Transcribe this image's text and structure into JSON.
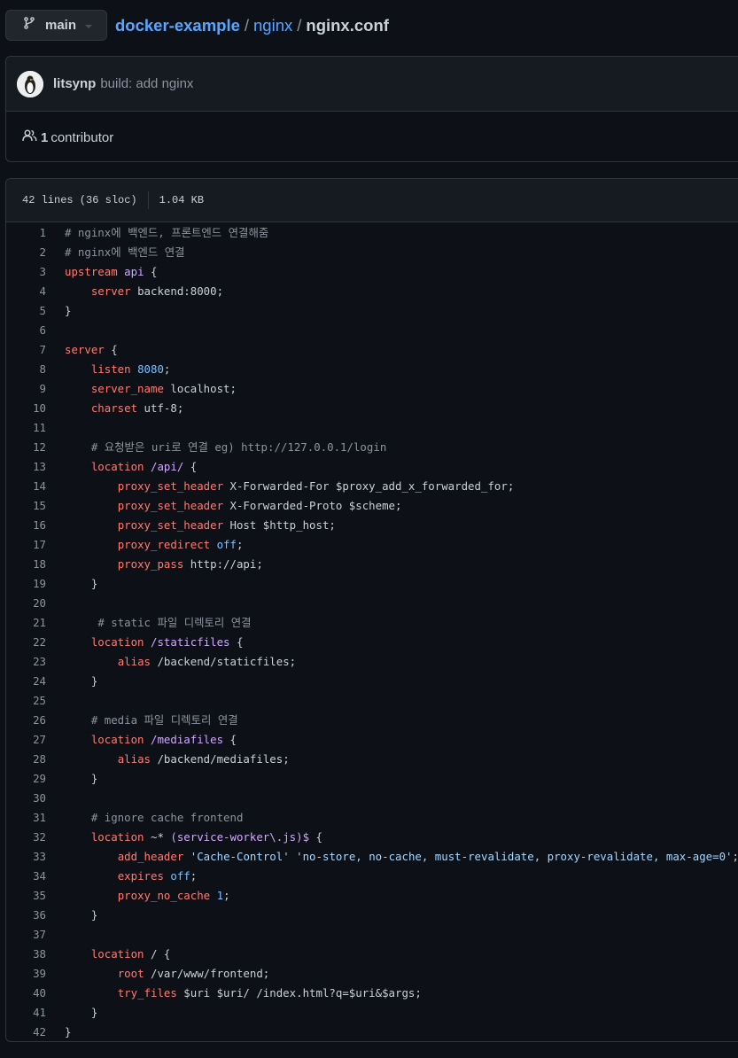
{
  "branch": {
    "name": "main"
  },
  "breadcrumb": {
    "repo": "docker-example",
    "dir": "nginx",
    "file": "nginx.conf"
  },
  "commit": {
    "author": "litsynp",
    "message": "build: add nginx"
  },
  "contributors": {
    "count": "1",
    "label": "contributor"
  },
  "file_info": {
    "lines": "42 lines (36 sloc)",
    "size": "1.04 KB"
  },
  "code_lines": [
    [
      [
        "com",
        "# nginx에 백엔드, 프론트엔드 연결해줌"
      ]
    ],
    [
      [
        "com",
        "# nginx에 백엔드 연결"
      ]
    ],
    [
      [
        "kw",
        "upstream"
      ],
      [
        "",
        " "
      ],
      [
        "id",
        "api"
      ],
      [
        "",
        " {"
      ]
    ],
    [
      [
        "",
        "    "
      ],
      [
        "kw",
        "server"
      ],
      [
        "",
        " backend:8000;"
      ]
    ],
    [
      [
        "",
        "}"
      ]
    ],
    [],
    [
      [
        "kw",
        "server"
      ],
      [
        "",
        " {"
      ]
    ],
    [
      [
        "",
        "    "
      ],
      [
        "kw",
        "listen"
      ],
      [
        "",
        " "
      ],
      [
        "num",
        "8080"
      ],
      [
        "",
        ";"
      ]
    ],
    [
      [
        "",
        "    "
      ],
      [
        "kw",
        "server_name"
      ],
      [
        "",
        " localhost;"
      ]
    ],
    [
      [
        "",
        "    "
      ],
      [
        "kw",
        "charset"
      ],
      [
        "",
        " utf-8;"
      ]
    ],
    [],
    [
      [
        "",
        "    "
      ],
      [
        "com",
        "# 요청받은 uri로 연결 eg) http://127.0.0.1/login"
      ]
    ],
    [
      [
        "",
        "    "
      ],
      [
        "kw",
        "location"
      ],
      [
        "",
        " "
      ],
      [
        "id",
        "/api/"
      ],
      [
        "",
        " {"
      ]
    ],
    [
      [
        "",
        "        "
      ],
      [
        "kw",
        "proxy_set_header"
      ],
      [
        "",
        " X-Forwarded-For $proxy_add_x_forwarded_for;"
      ]
    ],
    [
      [
        "",
        "        "
      ],
      [
        "kw",
        "proxy_set_header"
      ],
      [
        "",
        " X-Forwarded-Proto $scheme;"
      ]
    ],
    [
      [
        "",
        "        "
      ],
      [
        "kw",
        "proxy_set_header"
      ],
      [
        "",
        " Host $http_host;"
      ]
    ],
    [
      [
        "",
        "        "
      ],
      [
        "kw",
        "proxy_redirect"
      ],
      [
        "",
        " "
      ],
      [
        "num",
        "off"
      ],
      [
        "",
        ";"
      ]
    ],
    [
      [
        "",
        "        "
      ],
      [
        "kw",
        "proxy_pass"
      ],
      [
        "",
        " http://api;"
      ]
    ],
    [
      [
        "",
        "    }"
      ]
    ],
    [],
    [
      [
        "",
        "     "
      ],
      [
        "com",
        "# static 파일 디렉토리 연결"
      ]
    ],
    [
      [
        "",
        "    "
      ],
      [
        "kw",
        "location"
      ],
      [
        "",
        " "
      ],
      [
        "id",
        "/staticfiles"
      ],
      [
        "",
        " {"
      ]
    ],
    [
      [
        "",
        "        "
      ],
      [
        "kw",
        "alias"
      ],
      [
        "",
        " /backend/staticfiles;"
      ]
    ],
    [
      [
        "",
        "    }"
      ]
    ],
    [],
    [
      [
        "",
        "    "
      ],
      [
        "com",
        "# media 파일 디렉토리 연결"
      ]
    ],
    [
      [
        "",
        "    "
      ],
      [
        "kw",
        "location"
      ],
      [
        "",
        " "
      ],
      [
        "id",
        "/mediafiles"
      ],
      [
        "",
        " {"
      ]
    ],
    [
      [
        "",
        "        "
      ],
      [
        "kw",
        "alias"
      ],
      [
        "",
        " /backend/mediafiles;"
      ]
    ],
    [
      [
        "",
        "    }"
      ]
    ],
    [],
    [
      [
        "",
        "    "
      ],
      [
        "com",
        "# ignore cache frontend"
      ]
    ],
    [
      [
        "",
        "    "
      ],
      [
        "kw",
        "location"
      ],
      [
        "",
        " ~* "
      ],
      [
        "id",
        "(service-worker\\.js)$"
      ],
      [
        "",
        " {"
      ]
    ],
    [
      [
        "",
        "        "
      ],
      [
        "kw",
        "add_header"
      ],
      [
        "",
        " "
      ],
      [
        "str",
        "'Cache-Control'"
      ],
      [
        "",
        " "
      ],
      [
        "str",
        "'no-store, no-cache, must-revalidate, proxy-revalidate, max-age=0'"
      ],
      [
        "",
        ";"
      ]
    ],
    [
      [
        "",
        "        "
      ],
      [
        "kw",
        "expires"
      ],
      [
        "",
        " "
      ],
      [
        "num",
        "off"
      ],
      [
        "",
        ";"
      ]
    ],
    [
      [
        "",
        "        "
      ],
      [
        "kw",
        "proxy_no_cache"
      ],
      [
        "",
        " "
      ],
      [
        "num",
        "1"
      ],
      [
        "",
        ";"
      ]
    ],
    [
      [
        "",
        "    }"
      ]
    ],
    [],
    [
      [
        "",
        "    "
      ],
      [
        "kw",
        "location"
      ],
      [
        "",
        " / {"
      ]
    ],
    [
      [
        "",
        "        "
      ],
      [
        "kw",
        "root"
      ],
      [
        "",
        " /var/www/frontend;"
      ]
    ],
    [
      [
        "",
        "        "
      ],
      [
        "kw",
        "try_files"
      ],
      [
        "",
        " $uri $uri/ /index.html?q=$uri&$args;"
      ]
    ],
    [
      [
        "",
        "    }"
      ]
    ],
    [
      [
        "",
        "}"
      ]
    ]
  ],
  "colors": {
    "background": "#0d1117",
    "link": "#58a6ff",
    "keyword": "#ff7b72",
    "identifier": "#d2a8ff",
    "number": "#79c0ff",
    "string": "#a5d6ff",
    "comment": "#8b949e"
  },
  "icons": {
    "branch": "git-branch-icon",
    "contributors": "people-icon",
    "caret": "caret-down-icon"
  }
}
